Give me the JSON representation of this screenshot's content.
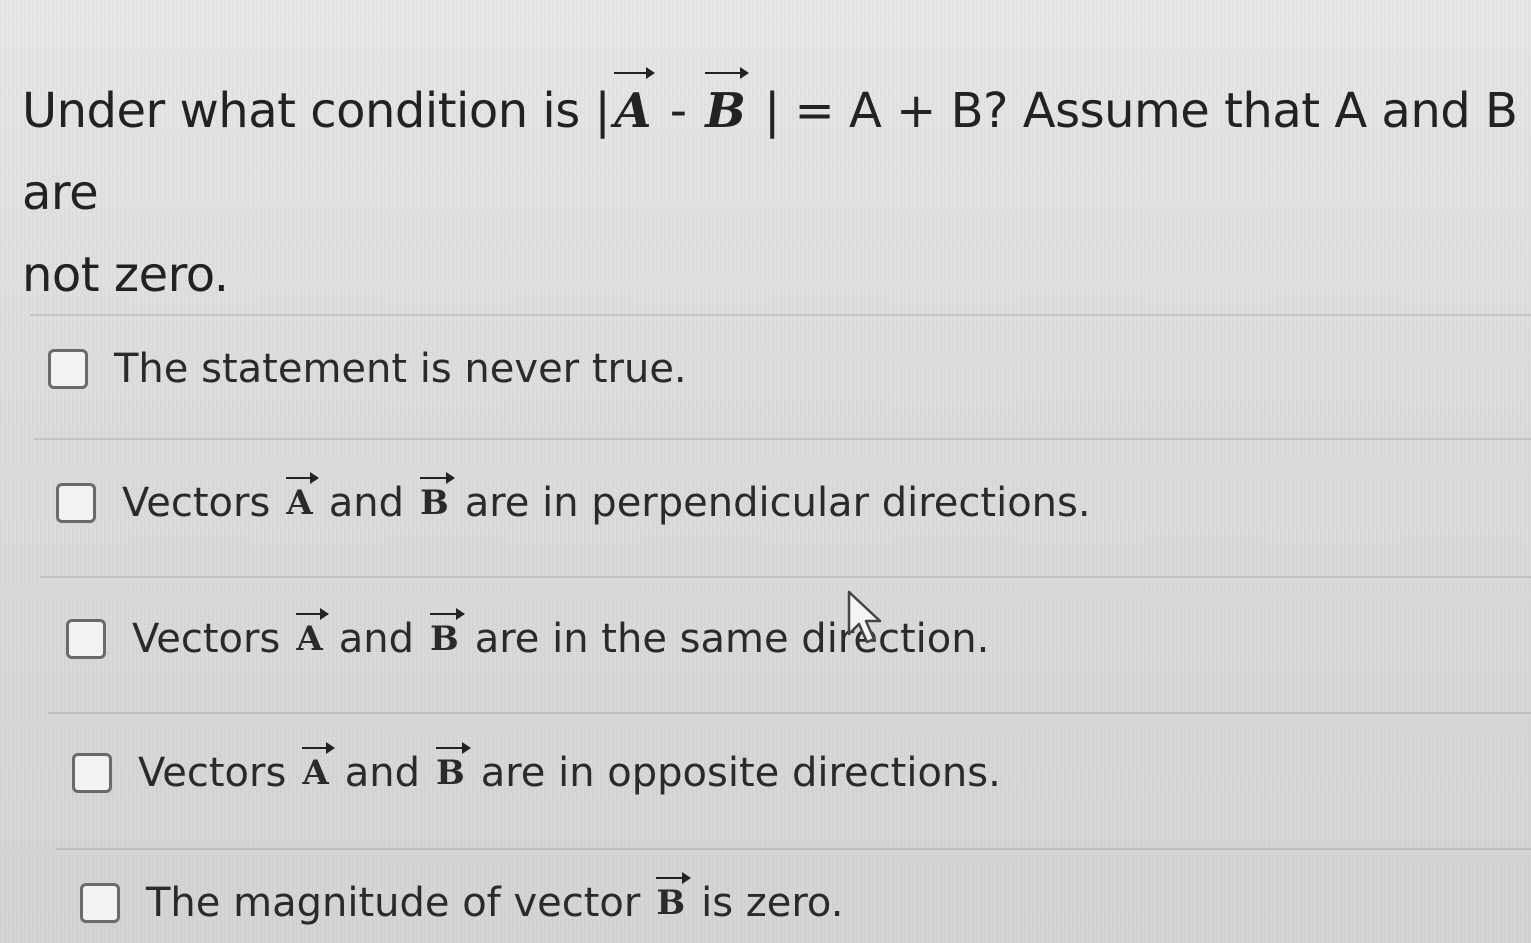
{
  "question": {
    "prefix": "Under what condition is |",
    "vec_a": "A",
    "minus": " - ",
    "vec_b": "B",
    "suffix_line1": " | = A + B? Assume that A and B are",
    "line2": "not zero."
  },
  "options": [
    {
      "id": "never-true",
      "parts": [
        "The statement is never true."
      ]
    },
    {
      "id": "perpendicular",
      "lead": "Vectors",
      "vec1": "A",
      "mid": "and",
      "vec2": "B",
      "tail": "are in perpendicular directions."
    },
    {
      "id": "same-direction",
      "lead": "Vectors",
      "vec1": "A",
      "mid": "and",
      "vec2": "B",
      "tail": "are in the same direction."
    },
    {
      "id": "opposite",
      "lead": "Vectors",
      "vec1": "A",
      "mid": "and",
      "vec2": "B",
      "tail": "are in opposite directions."
    },
    {
      "id": "b-zero",
      "lead": "The magnitude of vector",
      "vec1": "B",
      "tail": "is zero."
    }
  ],
  "colors": {
    "background": "#dcdcda",
    "text": "#222222",
    "checkbox_border": "#6a6a6a"
  },
  "icons": {
    "cursor": "mouse-pointer-icon",
    "checkbox": "checkbox-icon"
  }
}
